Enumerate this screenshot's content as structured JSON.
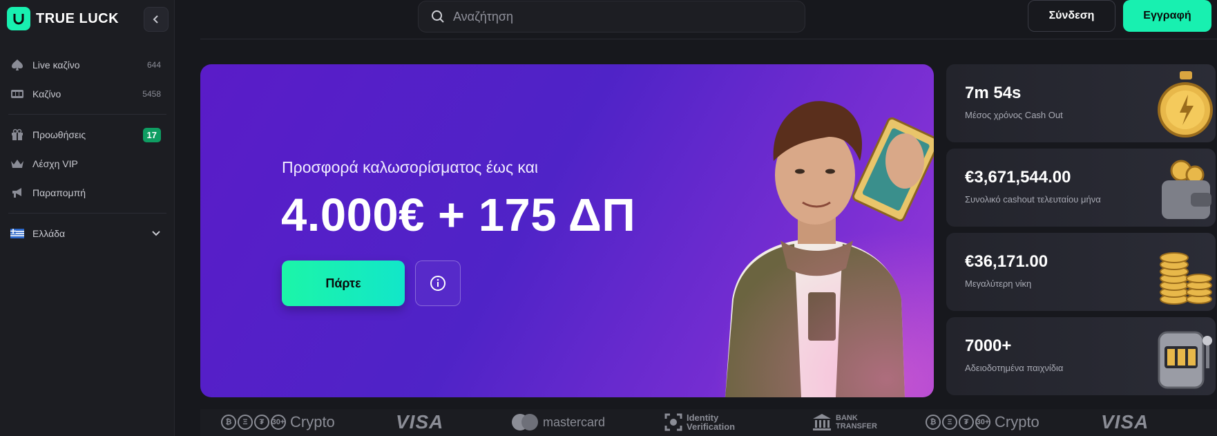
{
  "brand": {
    "name": "TRUE LUCK",
    "accent": "#18f0b0"
  },
  "sidebar": {
    "items": [
      {
        "label": "Live καζίνο",
        "count": "644",
        "icon": "spade-icon"
      },
      {
        "label": "Καζίνο",
        "count": "5458",
        "icon": "slot-machine-icon"
      },
      {
        "label": "Προωθήσεις",
        "badge": "17",
        "icon": "gift-icon"
      },
      {
        "label": "Λέσχη VIP",
        "icon": "crown-icon"
      },
      {
        "label": "Παραπομπή",
        "icon": "megaphone-icon"
      }
    ],
    "language": {
      "label": "Ελλάδα",
      "icon": "greece-flag-icon"
    }
  },
  "header": {
    "search_placeholder": "Αναζήτηση",
    "login_label": "Σύνδεση",
    "register_label": "Εγγραφή"
  },
  "hero": {
    "subtitle": "Προσφορά καλωσορίσματος έως και",
    "title": "4.000€ + 175 ΔΠ",
    "claim_label": "Πάρτε"
  },
  "stats": [
    {
      "value": "7m 54s",
      "label": "Μέσος χρόνος Cash Out",
      "icon": "stopwatch-icon"
    },
    {
      "value": "€3,671,544.00",
      "label": "Συνολικό cashout τελευταίου μήνα",
      "icon": "wallet-icon"
    },
    {
      "value": "€36,171.00",
      "label": "Μεγαλύτερη νίκη",
      "icon": "coins-stack-icon"
    },
    {
      "value": "7000+",
      "label": "Αδειοδοτημένα παιχνίδια",
      "icon": "slot-machine-icon"
    }
  ],
  "payments": {
    "crypto": "Crypto",
    "crypto_more": "30+",
    "visa": "VISA",
    "mastercard": "mastercard",
    "identity": [
      "Identity",
      "Verification"
    ],
    "bank": [
      "BANK",
      "TRANSFER"
    ]
  }
}
